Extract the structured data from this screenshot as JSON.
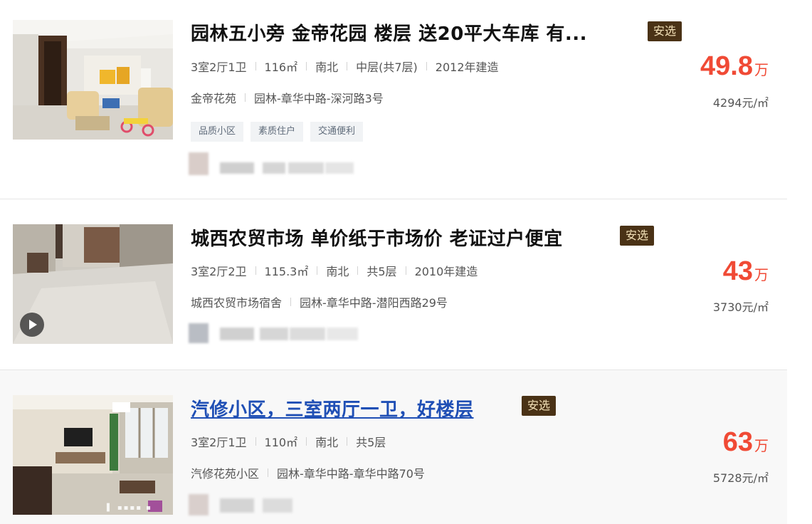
{
  "listings": [
    {
      "title": "园林五小旁 金帝花园 楼层 送20平大车库 有...",
      "badge": "安选",
      "layout": "3室2厅1卫",
      "area": "116㎡",
      "orientation": "南北",
      "floor": "中层(共7层)",
      "built": "2012年建造",
      "community": "金帝花苑",
      "location": "园林-章华中路-深河路3号",
      "tags": [
        "品质小区",
        "素质住户",
        "交通便利"
      ],
      "price": "49.8",
      "price_unit": "万",
      "unit_price": "4294元/㎡"
    },
    {
      "title": "城西农贸市场 单价纸于市场价 老证过户便宜",
      "badge": "安选",
      "layout": "3室2厅2卫",
      "area": "115.3㎡",
      "orientation": "南北",
      "floor": "共5层",
      "built": "2010年建造",
      "community": "城西农贸市场宿舍",
      "location": "园林-章华中路-潜阳西路29号",
      "price": "43",
      "price_unit": "万",
      "unit_price": "3730元/㎡"
    },
    {
      "title": "汽修小区，三室两厅一卫，好楼层",
      "badge": "安选",
      "layout": "3室2厅1卫",
      "area": "110㎡",
      "orientation": "南北",
      "floor": "共5层",
      "community": "汽修花苑小区",
      "location": "园林-章华中路-章华中路70号",
      "price": "63",
      "price_unit": "万",
      "unit_price": "5728元/㎡"
    }
  ],
  "colors": {
    "price": "#f04a35",
    "badge_bg": "#4a3216",
    "badge_text": "#f3e1b8",
    "link": "#1f4fb5"
  },
  "icons": [
    "play-icon"
  ]
}
